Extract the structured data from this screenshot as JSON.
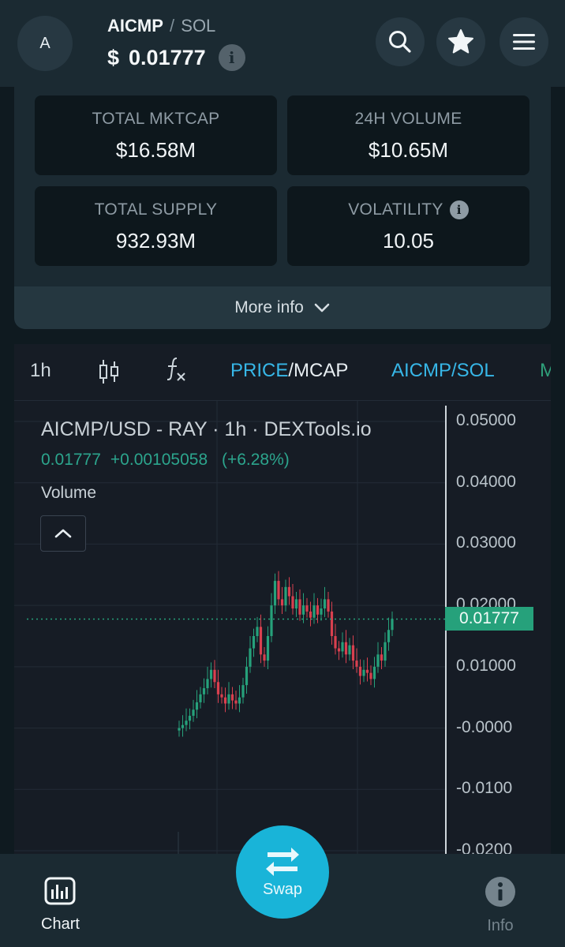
{
  "header": {
    "avatar_letter": "A",
    "base_symbol": "AICMP",
    "separator": "/",
    "quote_symbol": "SOL",
    "price_currency": "$",
    "price_value": "0.01777",
    "info_glyph": "i"
  },
  "stats": {
    "total_mktcap": {
      "label": "TOTAL MKTCAP",
      "value": "$16.58M"
    },
    "volume_24h": {
      "label": "24H VOLUME",
      "value": "$10.65M"
    },
    "total_supply": {
      "label": "TOTAL SUPPLY",
      "value": "932.93M"
    },
    "volatility": {
      "label": "VOLATILITY",
      "value": "10.05"
    },
    "more_info_label": "More info"
  },
  "chart_toolbar": {
    "interval": "1h",
    "price_label": "PRICE",
    "slash": "/",
    "mcap_label": "MCAP",
    "pair_label": "AICMP/SOL",
    "overflow_label": "M"
  },
  "chart_data": {
    "type": "candlestick",
    "title": "AICMP/USD - RAY · 1h · DEXTools.io",
    "last": "0.01777",
    "change": "+0.00105058",
    "change_pct": "(+6.28%)",
    "volume_label": "Volume",
    "y_ticks": [
      "0.05000",
      "0.04000",
      "0.03000",
      "0.02000",
      "0.01000",
      "-0.0000",
      "-0.0100",
      "-0.0200"
    ],
    "y_range": [
      -0.02,
      0.05
    ],
    "last_price_label": "0.01777",
    "close_series": [
      0.0,
      0.0005,
      0.0012,
      0.002,
      0.003,
      0.0042,
      0.0055,
      0.0065,
      0.008,
      0.0095,
      0.0075,
      0.0055,
      0.005,
      0.004,
      0.0055,
      0.0045,
      0.004,
      0.005,
      0.007,
      0.01,
      0.013,
      0.015,
      0.0165,
      0.012,
      0.011,
      0.015,
      0.02,
      0.024,
      0.021,
      0.02,
      0.023,
      0.0215,
      0.0195,
      0.021,
      0.0185,
      0.02,
      0.019,
      0.018,
      0.02,
      0.0185,
      0.0195,
      0.021,
      0.019,
      0.015,
      0.013,
      0.0125,
      0.014,
      0.012,
      0.0135,
      0.011,
      0.01,
      0.0085,
      0.0095,
      0.009,
      0.008,
      0.01,
      0.012,
      0.011,
      0.014,
      0.016,
      0.0178
    ]
  },
  "bottom_nav": {
    "chart_label": "Chart",
    "swap_label": "Swap",
    "info_label": "Info"
  },
  "colors": {
    "accent": "#19b4d8",
    "up": "#26a17b",
    "down": "#d9404f",
    "background": "#0f1a20"
  }
}
